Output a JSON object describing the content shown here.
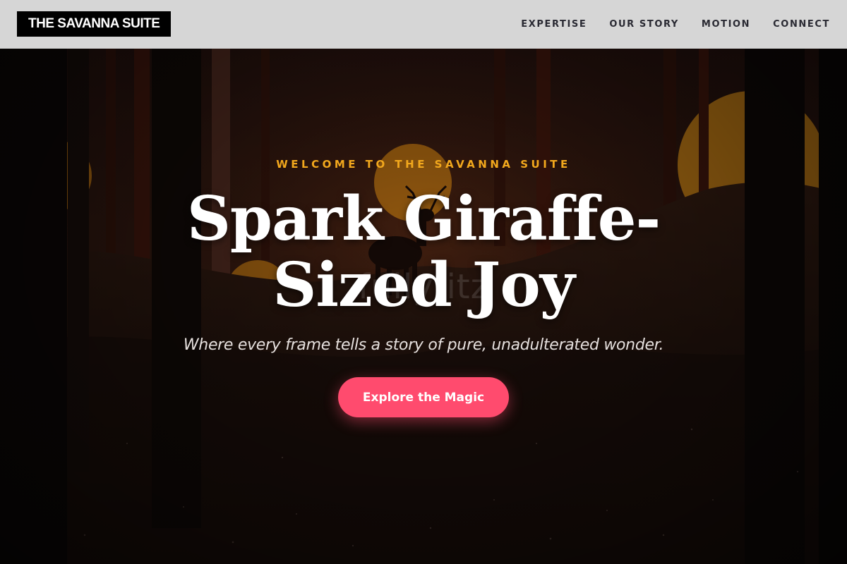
{
  "header": {
    "logo_text": "THE SAVANNA SUITE",
    "nav": [
      {
        "label": "EXPERTISE"
      },
      {
        "label": "OUR STORY"
      },
      {
        "label": "MOTION"
      },
      {
        "label": "CONNECT"
      }
    ]
  },
  "hero": {
    "eyebrow": "WELCOME TO THE SAVANNA SUITE",
    "headline_line1": "Spark Giraffe-",
    "headline_line2": "Sized Joy",
    "watermark": "fullyfitz",
    "subtitle": "Where every frame tells a story of pure, unadulterated wonder.",
    "cta_label": "Explore the Magic"
  },
  "colors": {
    "header_bg": "#d6d6d6",
    "logo_bg": "#000000",
    "accent_gold": "#f2a81d",
    "cta_pink": "#ff4b6e",
    "sun_orange": "#e8981c"
  }
}
